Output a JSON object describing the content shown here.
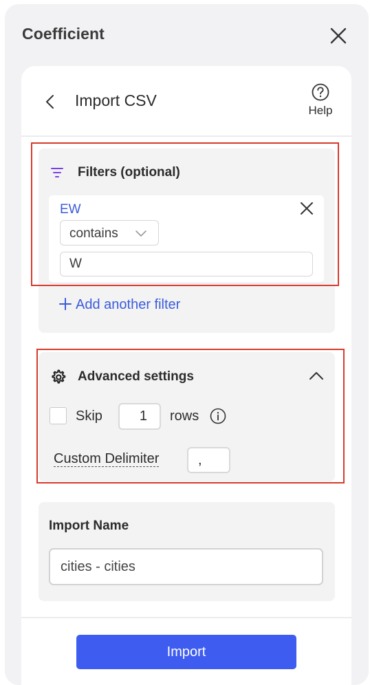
{
  "app": {
    "title": "Coefficient"
  },
  "header": {
    "title": "Import CSV",
    "help_label": "Help"
  },
  "filters": {
    "title": "Filters (optional)",
    "items": [
      {
        "field": "EW",
        "operator": "contains",
        "value": "W"
      }
    ],
    "add_label": "Add another filter"
  },
  "advanced": {
    "title": "Advanced settings",
    "skip_label": "Skip",
    "skip_checked": false,
    "skip_rows": "1",
    "rows_label": "rows",
    "delimiter_label": "Custom Delimiter",
    "delimiter_value": ","
  },
  "import_name": {
    "label": "Import Name",
    "value": "cities - cities"
  },
  "footer": {
    "import_label": "Import"
  },
  "colors": {
    "accent": "#3e5cf0",
    "link": "#3b5bdb",
    "highlight": "#d63a2a"
  },
  "icons": [
    "close-icon",
    "back-chevron-icon",
    "help-circle-icon",
    "filter-icon",
    "gear-icon",
    "chevron-up-icon",
    "chevron-down-icon",
    "info-icon",
    "plus-icon"
  ]
}
